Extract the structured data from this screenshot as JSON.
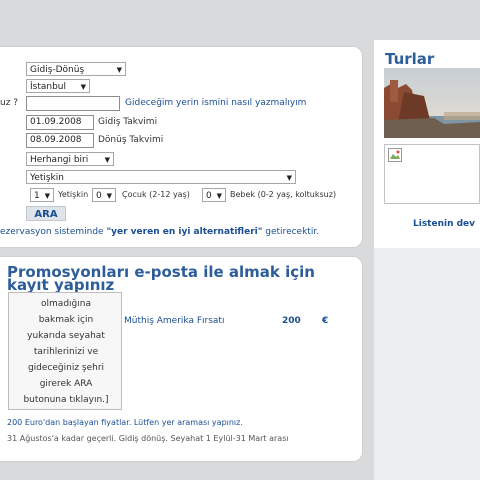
{
  "form": {
    "trip_type": "Gidiş-Dönüş",
    "from": "İstanbul",
    "to_label_fragment": "uz ?",
    "to_value": "",
    "to_help_link": "Gideceğim yerin ismini nasıl yazmalıyım",
    "depart_date": "01.09.2008",
    "depart_label": "Gidiş Takvimi",
    "return_date": "08.09.2008",
    "return_label": "Dönüş Takvimi",
    "airline": "Herhangi biri",
    "passenger_class": "Yetişkin",
    "adult_count": "1",
    "adult_label": "Yetişkin",
    "child_count": "0",
    "child_label": "Çocuk (2-12 yaş)",
    "infant_count": "0",
    "infant_label": "Bebek (0-2 yaş, koltuksuz)",
    "search_button": "ARA",
    "info_prefix": "ezervasyon sisteminde ",
    "info_bold": "\"yer veren en iyi alternatifleri\"",
    "info_suffix": " getirecektir."
  },
  "promo": {
    "title_line1": "Promosyonları e-posta ile almak için",
    "title_line2": "kayıt yapınız",
    "tooltip_lines": [
      "olmadığına",
      "bakmak için",
      "yukarıda seyahat",
      "tarihlerinizi ve",
      "gideceğiniz şehri",
      "girerek ARA",
      "butonuna tıklayın.]"
    ],
    "offer_name": "Müthiş Amerika Fırsatı",
    "offer_price": "200",
    "offer_currency": "€",
    "note1": "200 Euro'dan başlayan fiyatlar. Lütfen yer araması yapınız.",
    "note2": "31 Ağustos'a kadar geçerli. Gidiş dönüş. Seyahat 1 Eylül-31 Mart arası"
  },
  "sidebar": {
    "title": "Turlar",
    "list_link": "Listenin dev"
  },
  "icons": {
    "dropdown": "chevron-down-icon",
    "broken": "broken-image-icon"
  }
}
